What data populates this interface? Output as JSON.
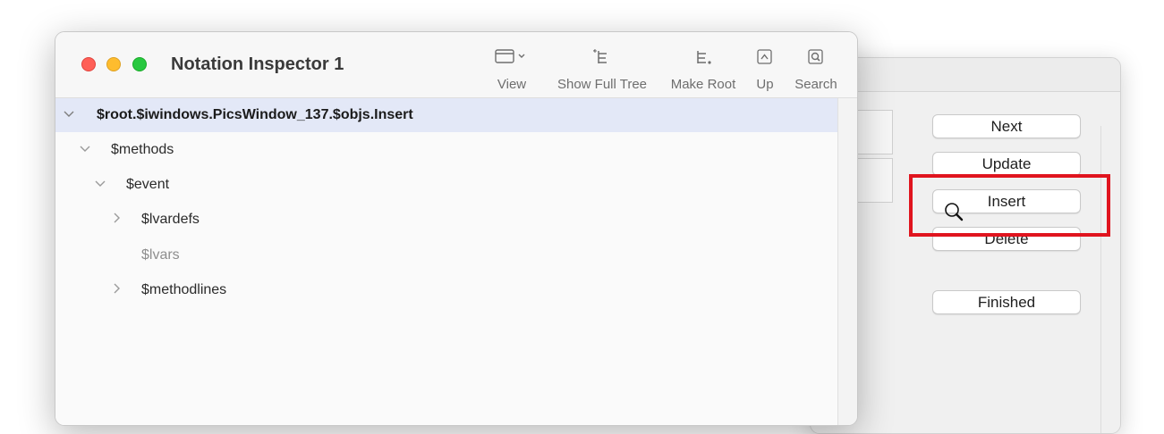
{
  "front_window": {
    "title": "Notation Inspector 1",
    "toolbar": [
      {
        "label": "View",
        "icon": "sidebar-view-icon"
      },
      {
        "label": "Show Full Tree",
        "icon": "full-tree-icon"
      },
      {
        "label": "Make Root",
        "icon": "make-root-icon"
      },
      {
        "label": "Up",
        "icon": "up-arrow-icon"
      },
      {
        "label": "Search",
        "icon": "search-icon"
      }
    ],
    "tree": [
      {
        "label": "$root.$iwindows.PicsWindow_137.$objs.Insert",
        "expanded": true,
        "selected": true
      },
      {
        "label": "$methods",
        "expanded": true
      },
      {
        "label": "$event",
        "expanded": true
      },
      {
        "label": "$lvardefs",
        "expanded": false
      },
      {
        "label": "$lvars",
        "leaf": true
      },
      {
        "label": "$methodlines",
        "expanded": false
      }
    ]
  },
  "back_window": {
    "buttons": [
      "Next",
      "Update",
      "Insert",
      "Delete",
      "Finished"
    ]
  },
  "colors": {
    "highlight": "#e0141e",
    "selection": "#e3e8f7"
  }
}
